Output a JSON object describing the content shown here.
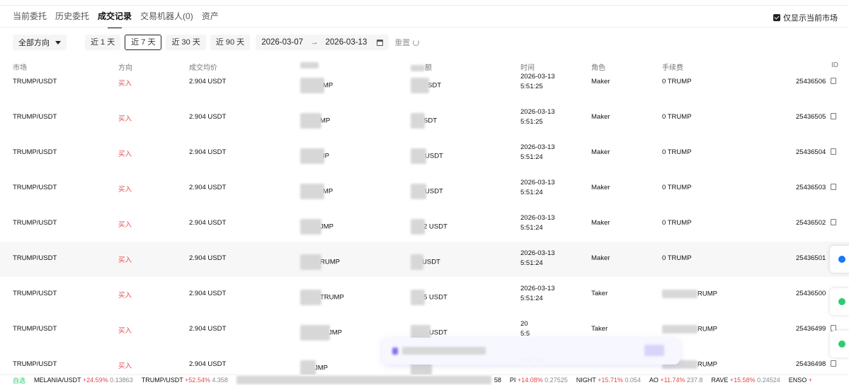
{
  "tabs": [
    {
      "label": "当前委托"
    },
    {
      "label": "历史委托"
    },
    {
      "label": "成交记录",
      "active": true
    },
    {
      "label": "交易机器人(0)"
    },
    {
      "label": "资产"
    }
  ],
  "only_current_market": {
    "label": "仅显示当前市场",
    "checked": true
  },
  "filters": {
    "direction": "全部方向",
    "ranges": [
      "近 1 天",
      "近 7 天",
      "近 30 天",
      "近 90 天"
    ],
    "active_range": "近 7 天",
    "date_start": "2026-03-07",
    "date_end": "2026-03-13",
    "reset_label": "重置"
  },
  "columns": {
    "market": "市场",
    "side": "方向",
    "avg_price": "成交均价",
    "qty": "",
    "amount": "额",
    "time": "时间",
    "role": "角色",
    "fee": "手续费",
    "id": "ID"
  },
  "rows": [
    {
      "market": "TRUMP/USDT",
      "side": "买入",
      "price": "2.904 USDT",
      "qty": "MP",
      "amount": "SDT",
      "date": "2026-03-13",
      "time": "5:51:25",
      "role": "Maker",
      "fee": "0 TRUMP",
      "id": "25436506"
    },
    {
      "market": "TRUMP/USDT",
      "side": "买入",
      "price": "2.904 USDT",
      "qty": "MP",
      "amount": "SDT",
      "date": "2026-03-13",
      "time": "5:51:25",
      "role": "Maker",
      "fee": "0 TRUMP",
      "id": "25436505"
    },
    {
      "market": "TRUMP/USDT",
      "side": "买入",
      "price": "2.904 USDT",
      "qty": "IP",
      "amount": "USDT",
      "date": "2026-03-13",
      "time": "5:51:24",
      "role": "Maker",
      "fee": "0 TRUMP",
      "id": "25436504"
    },
    {
      "market": "TRUMP/USDT",
      "side": "买入",
      "price": "2.904 USDT",
      "qty": "MP",
      "amount": "USDT",
      "date": "2026-03-13",
      "time": "5:51:24",
      "role": "Maker",
      "fee": "0 TRUMP",
      "id": "25436503"
    },
    {
      "market": "TRUMP/USDT",
      "side": "买入",
      "price": "2.904 USDT",
      "qty": "JMP",
      "amount": "2 USDT",
      "date": "2026-03-13",
      "time": "5:51:24",
      "role": "Maker",
      "fee": "0 TRUMP",
      "id": "25436502"
    },
    {
      "market": "TRUMP/USDT",
      "side": "买入",
      "price": "2.904 USDT",
      "qty": "RUMP",
      "amount": "USDT",
      "date": "2026-03-13",
      "time": "5:51:24",
      "role": "Maker",
      "fee": "0 TRUMP",
      "id": "25436501"
    },
    {
      "market": "TRUMP/USDT",
      "side": "买入",
      "price": "2.904 USDT",
      "qty": "TRUMP",
      "amount": "5 USDT",
      "date": "2026-03-13",
      "time": "5:51:24",
      "role": "Taker",
      "fee": "RUMP",
      "id": "25436500"
    },
    {
      "market": "TRUMP/USDT",
      "side": "买入",
      "price": "2.904 USDT",
      "qty": "JMP",
      "amount": "USDT",
      "date": "20",
      "time": "5:5",
      "role": "Taker",
      "fee": "RUMP",
      "id": "25436499"
    },
    {
      "market": "TRUMP/USDT",
      "side": "买入",
      "price": "2.904 USDT",
      "qty": "JMP",
      "amount": "",
      "date": "",
      "time": "5:51:24",
      "role": "",
      "fee": "RUMP",
      "id": "25436498"
    }
  ],
  "ticker": [
    {
      "name": "自选",
      "change": "",
      "price": ""
    },
    {
      "name": "MELANIA/USDT",
      "change": "+24.59%",
      "price": "0.13863"
    },
    {
      "name": "TRUMP/USDT",
      "change": "+52.54%",
      "price": "4.358"
    },
    {
      "name": "58",
      "change": "",
      "price": ""
    },
    {
      "name": "PI",
      "change": "+14.08%",
      "price": "0.27525"
    },
    {
      "name": "NIGHT",
      "change": "+15.71%",
      "price": "0.054"
    },
    {
      "name": "AO",
      "change": "+11.74%",
      "price": "237.8"
    },
    {
      "name": "RAVE",
      "change": "+15.58%",
      "price": "0.24524"
    },
    {
      "name": "ENSO",
      "change": "+",
      "price": ""
    }
  ],
  "colors": {
    "buy": "#e5484d",
    "accent": "#111111",
    "notify_blue": "#1677ff",
    "notify_green": "#2ecc71"
  }
}
